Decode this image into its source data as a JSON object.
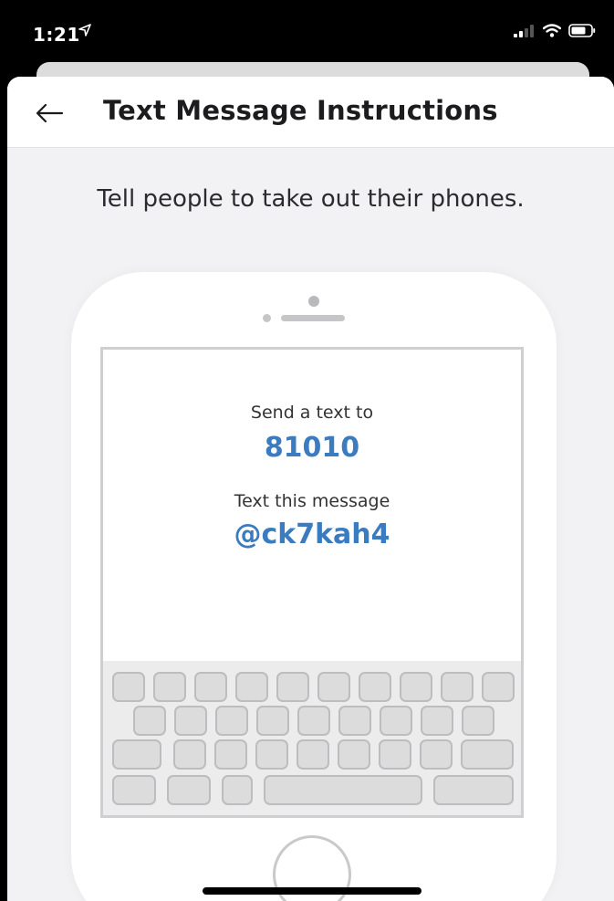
{
  "status": {
    "time": "1:21",
    "icons": [
      "location-arrow-icon",
      "signal-icon",
      "wifi-icon",
      "battery-icon"
    ]
  },
  "nav": {
    "title": "Text Message Instructions",
    "back_icon": "arrow-left-icon"
  },
  "instruction": "Tell people to take out their phones.",
  "phone_screen": {
    "send_label": "Send a text to",
    "number": "81010",
    "message_label": "Text this message",
    "code": "@ck7kah4"
  },
  "colors": {
    "accent": "#3b7bbf",
    "background": "#f2f2f4"
  }
}
